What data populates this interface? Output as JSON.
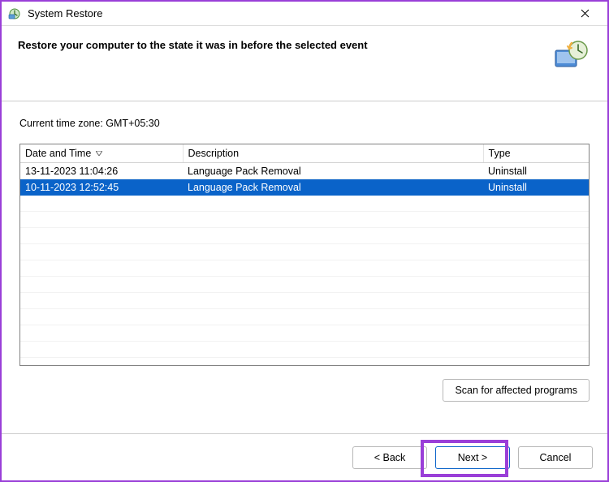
{
  "titlebar": {
    "title": "System Restore"
  },
  "header": {
    "text": "Restore your computer to the state it was in before the selected event"
  },
  "timezone_label": "Current time zone: GMT+05:30",
  "table": {
    "columns": {
      "date": "Date and Time",
      "description": "Description",
      "type": "Type"
    },
    "rows": [
      {
        "date": "13-11-2023 11:04:26",
        "description": "Language Pack Removal",
        "type": "Uninstall",
        "selected": false
      },
      {
        "date": "10-11-2023 12:52:45",
        "description": "Language Pack Removal",
        "type": "Uninstall",
        "selected": true
      }
    ]
  },
  "buttons": {
    "scan": "Scan for affected programs",
    "back": "< Back",
    "next": "Next >",
    "cancel": "Cancel"
  }
}
